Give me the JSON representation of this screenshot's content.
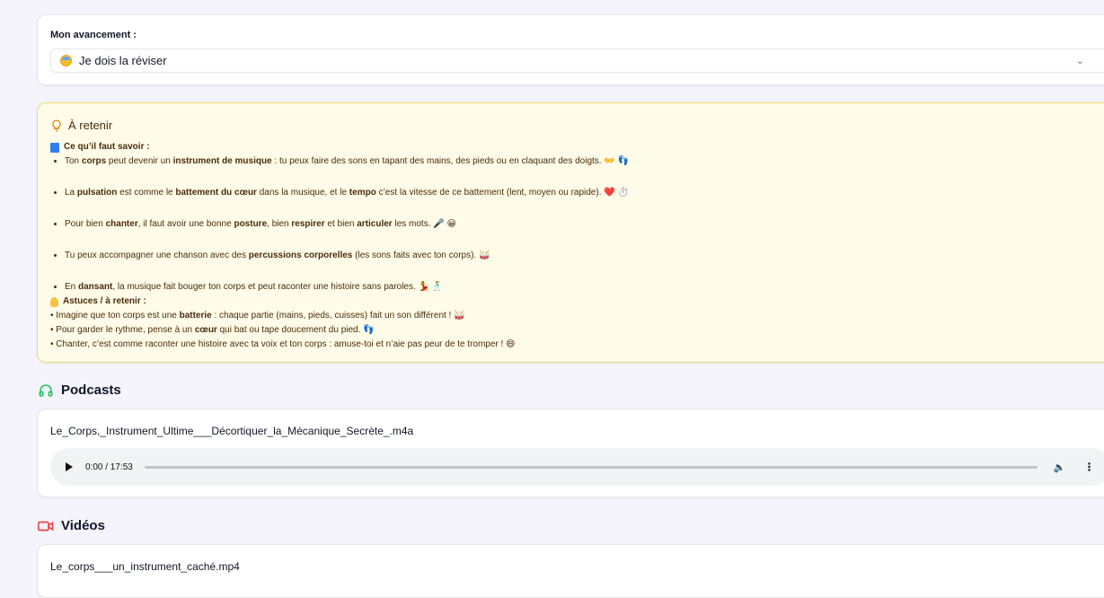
{
  "progress": {
    "label": "Mon avancement :",
    "selected": "Je dois la réviser",
    "chevron_icon": "chevron-down-icon"
  },
  "retain": {
    "title": "À retenir",
    "know_header": "Ce qu’il faut savoir :",
    "facts": [
      {
        "parts": [
          "Ton ",
          "corps",
          " peut devenir un ",
          "instrument de musique",
          " : tu peux faire des sons en tapant des mains, des pieds ou en claquant des doigts. 👐 👣"
        ]
      },
      {
        "parts": [
          "La ",
          "pulsation",
          " est comme le ",
          "battement du cœur",
          " dans la musique, et le ",
          "tempo",
          " c’est la vitesse de ce battement (lent, moyen ou rapide). ❤️ ⏱️"
        ]
      },
      {
        "parts": [
          "Pour bien ",
          "chanter",
          ", il faut avoir une bonne ",
          "posture",
          ", bien ",
          "respirer",
          " et bien ",
          "articuler",
          " les mots. 🎤 😀"
        ]
      },
      {
        "parts": [
          "Tu peux accompagner une chanson avec des ",
          "percussions corporelles",
          " (les sons faits avec ton corps). 🥁"
        ]
      },
      {
        "parts": [
          "En ",
          "dansant",
          ", la musique fait bouger ton corps et peut raconter une histoire sans paroles. 💃 🕺"
        ]
      }
    ],
    "tips_header": "Astuces / à retenir :",
    "tips": [
      {
        "parts": [
          "• Imagine que ton corps est une ",
          "batterie",
          " : chaque partie (mains, pieds, cuisses) fait un son différent ! 🥁"
        ]
      },
      {
        "parts": [
          "• Pour garder le rythme, pense à un ",
          "cœur",
          " qui bat ou tape doucement du pied. 👣"
        ]
      },
      {
        "parts": [
          "• Chanter, c’est comme raconter une histoire avec ta voix et ton corps : amuse-toi et n’aie pas peur de te tromper ! 😄",
          "",
          ""
        ]
      }
    ]
  },
  "podcasts": {
    "title": "Podcasts",
    "file": "Le_Corps,_Instrument_Ultime___Décortiquer_la_Mécanique_Secrète_.m4a",
    "time": "0:00 / 17:53",
    "progress_fraction": 0
  },
  "videos": {
    "title": "Vidéos",
    "file": "Le_corps___un_instrument_caché.mp4"
  },
  "colors": {
    "podcast_icon": "#22c55e",
    "video_icon": "#ef4444",
    "retain_bg": "#fefbe8",
    "retain_border": "#f2d77a"
  }
}
